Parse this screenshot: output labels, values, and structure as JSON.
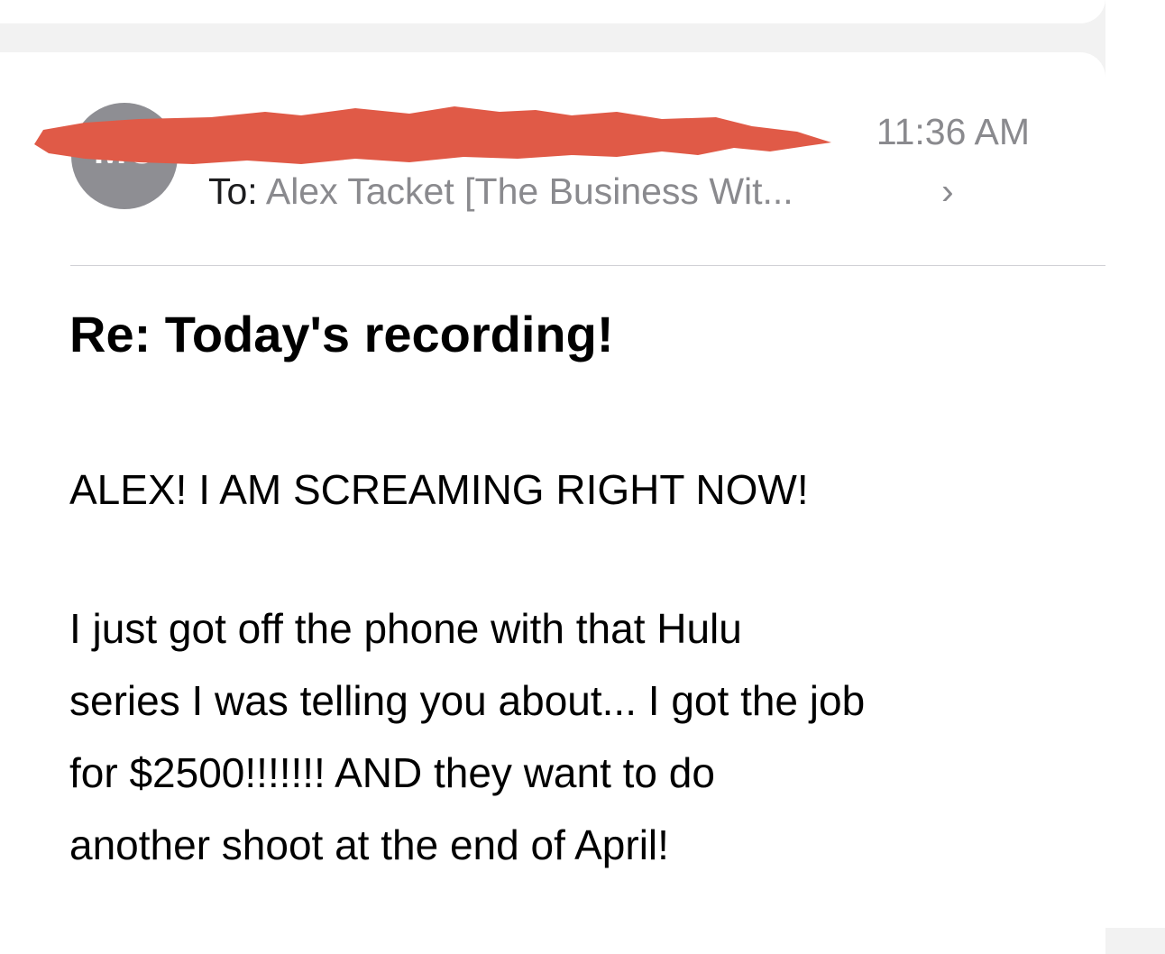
{
  "header": {
    "avatar_initials": "MC",
    "time": "11:36 AM",
    "to_label": "To:",
    "to_value": "Alex Tacket [The Business Wit...",
    "chevron": "›"
  },
  "email": {
    "subject": "Re: Today's recording!",
    "paragraph1": "ALEX! I AM SCREAMING RIGHT NOW!",
    "paragraph2_lines": [
      "I just got off the phone with that Hulu",
      "series I was telling you about... I got the job",
      "for $2500!!!!!!! AND they want to do",
      "another shoot at the end of April!"
    ]
  },
  "colors": {
    "redaction": "#e05a47",
    "avatar": "#8e8e93",
    "secondary_text": "#8a8a8e"
  }
}
